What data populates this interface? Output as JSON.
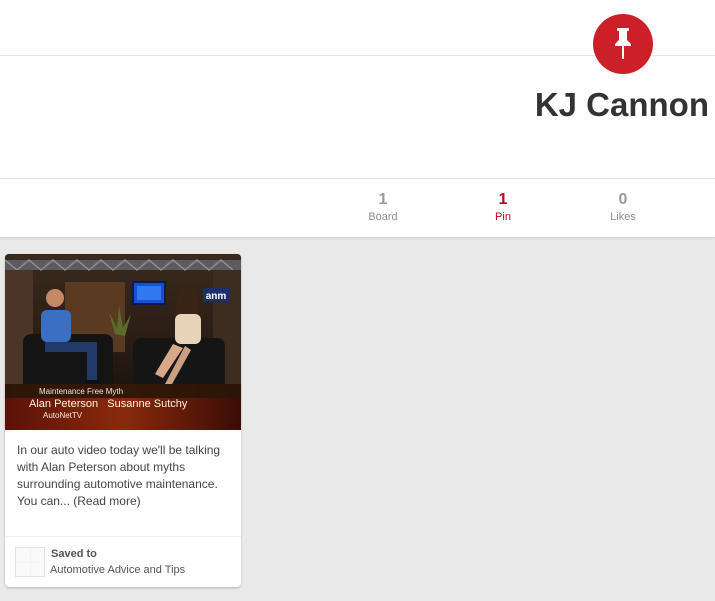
{
  "profile": {
    "name": "KJ Cannon",
    "badge_icon": "pushpin-icon",
    "badge_color": "#cb2027"
  },
  "stats": [
    {
      "count": "1",
      "label": "Board",
      "active": false
    },
    {
      "count": "1",
      "label": "Pin",
      "active": true
    },
    {
      "count": "0",
      "label": "Likes",
      "active": false
    }
  ],
  "pin": {
    "image": {
      "caption_line1": "Maintenance Free Myth",
      "caption_line2": "Alan Peterson   Susanne Sutchy",
      "caption_line3": "AutoNetTV",
      "logo_text": "anm"
    },
    "description": "In our auto video today we'll be talking with Alan Peterson about myths surrounding automotive maintenance. You can... (Read more)",
    "saved_to_label": "Saved to",
    "board_name": "Automotive Advice and Tips"
  },
  "colors": {
    "accent": "#b5071a",
    "background": "#e9e9e9"
  }
}
